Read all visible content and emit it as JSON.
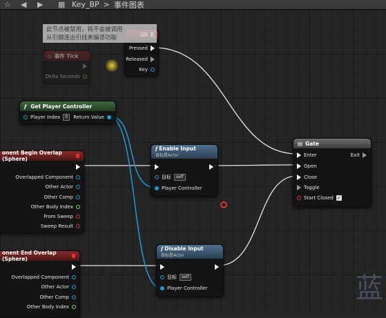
{
  "toolbar": {
    "breadcrumb_bp": "Key_BP",
    "breadcrumb_sep": ">",
    "breadcrumb_graph": "事件图表"
  },
  "tooltip": {
    "line1": "此节点被禁用，将不会被调用",
    "line2": "从引脚连出引线来编译功能"
  },
  "nodes": {
    "input_key": {
      "header": "E",
      "pressed": "Pressed",
      "released": "Released",
      "key": "Key"
    },
    "event_tick": {
      "header": "事件 Tick",
      "delta": "Delta Seconds"
    },
    "get_player_controller": {
      "header": "Get Player Controller",
      "player_index_label": "Player Index",
      "player_index_value": "0",
      "return_value": "Return Value"
    },
    "begin_overlap": {
      "header": "onent Begin Overlap (Sphere)",
      "pins": [
        "Overlapped Component",
        "Other Actor",
        "Other Comp",
        "Other Body Index",
        "From Sweep",
        "Sweep Result"
      ]
    },
    "end_overlap": {
      "header": "onent End Overlap (Sphere)",
      "pins": [
        "Overlapped Component",
        "Other Actor",
        "Other Comp",
        "Other Body Index"
      ]
    },
    "enable_input": {
      "header": "Enable Input",
      "subtitle": "目标是Actor",
      "target_label": "目标",
      "target_value": "self",
      "player_controller": "Player Controller"
    },
    "disable_input": {
      "header": "Disable Input",
      "subtitle": "目标是Actor",
      "target_label": "目标",
      "target_value": "self",
      "player_controller": "Player Controller"
    },
    "gate": {
      "header": "Gate",
      "enter": "Enter",
      "exit": "Exit",
      "open": "Open",
      "close": "Close",
      "toggle": "Toggle",
      "start_closed": "Start Closed"
    }
  },
  "watermark": "蓝",
  "colors": {
    "exec": "#ffffff",
    "object_pin": "#1d9ad8",
    "function_header": "#4d6f8f",
    "pure_header": "#3f6a3f",
    "event_header": "#8a2a2a"
  }
}
